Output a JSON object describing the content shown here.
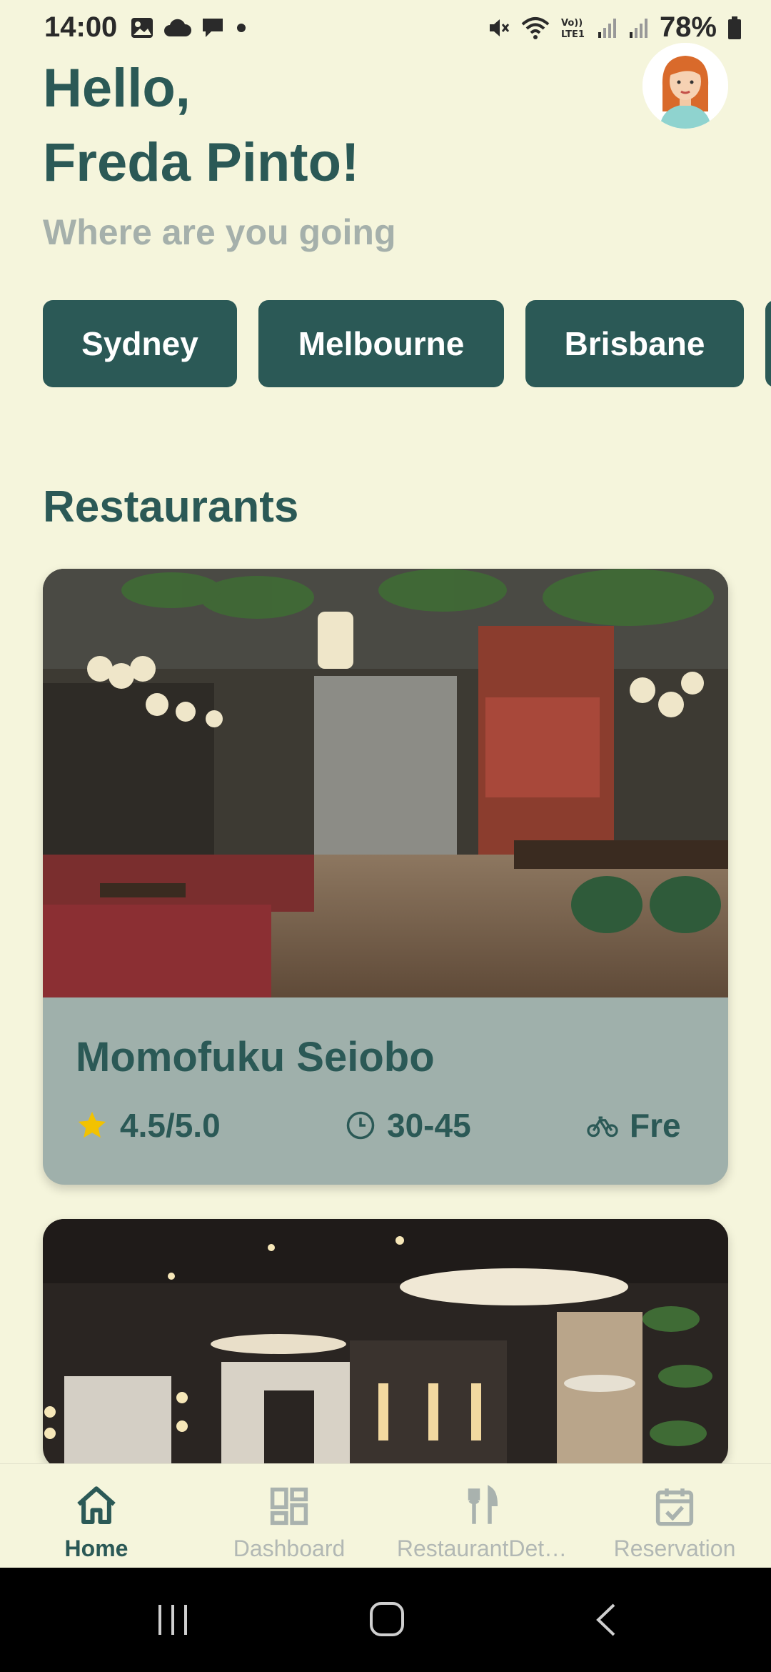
{
  "status_bar": {
    "time": "14:00",
    "battery": "78%",
    "left_icons": [
      "gallery-icon",
      "cloud-icon",
      "chat-bubble-icon",
      "dot-icon"
    ],
    "right_icons": [
      "mute-icon",
      "wifi-icon",
      "volte-icon",
      "signal-icon",
      "signal-icon",
      "battery-icon"
    ]
  },
  "header": {
    "greeting_line1": "Hello,",
    "greeting_line2": "Freda Pinto!",
    "subtitle": "Where are you going"
  },
  "cities": [
    "Sydney",
    "Melbourne",
    "Brisbane"
  ],
  "section": {
    "title": "Restaurants"
  },
  "restaurants": [
    {
      "name": "Momofuku Seiobo",
      "rating": "4.5/5.0",
      "time": "30-45",
      "delivery": "Fre"
    }
  ],
  "bottom_nav": [
    {
      "label": "Home",
      "icon": "home-icon",
      "active": true
    },
    {
      "label": "Dashboard",
      "icon": "dashboard-icon",
      "active": false
    },
    {
      "label": "RestaurantDet…",
      "icon": "fork-knife-icon",
      "active": false
    },
    {
      "label": "Reservation",
      "icon": "calendar-check-icon",
      "active": false
    }
  ],
  "colors": {
    "background": "#f5f5dc",
    "primary": "#2b5956",
    "card_footer": "#9fb0ab",
    "muted": "#a5b0ab",
    "star": "#f2c200"
  }
}
